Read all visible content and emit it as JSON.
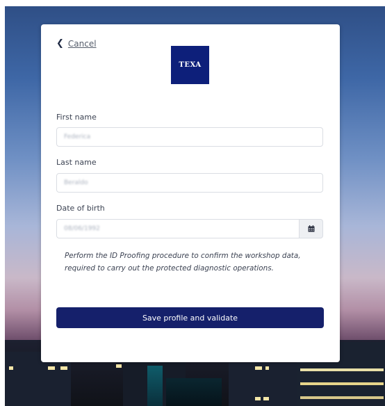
{
  "login": {
    "cancel_label": "Cancel",
    "logo_text": "TEXA",
    "fields": {
      "first_name": {
        "label": "First name",
        "value": "Federica"
      },
      "last_name": {
        "label": "Last name",
        "value": "Beraldo"
      },
      "date_of_birth": {
        "label": "Date of birth",
        "value": "08/06/1992"
      }
    },
    "info_text": "Perform the ID Proofing procedure to confirm the workshop data, required to carry out the protected diagnostic operations.",
    "save_label": "Save profile and validate"
  },
  "icons": {
    "back": "chevron-left-icon",
    "calendar": "calendar-icon"
  },
  "colors": {
    "brand": "#0d1f7a",
    "button": "#15206b"
  }
}
